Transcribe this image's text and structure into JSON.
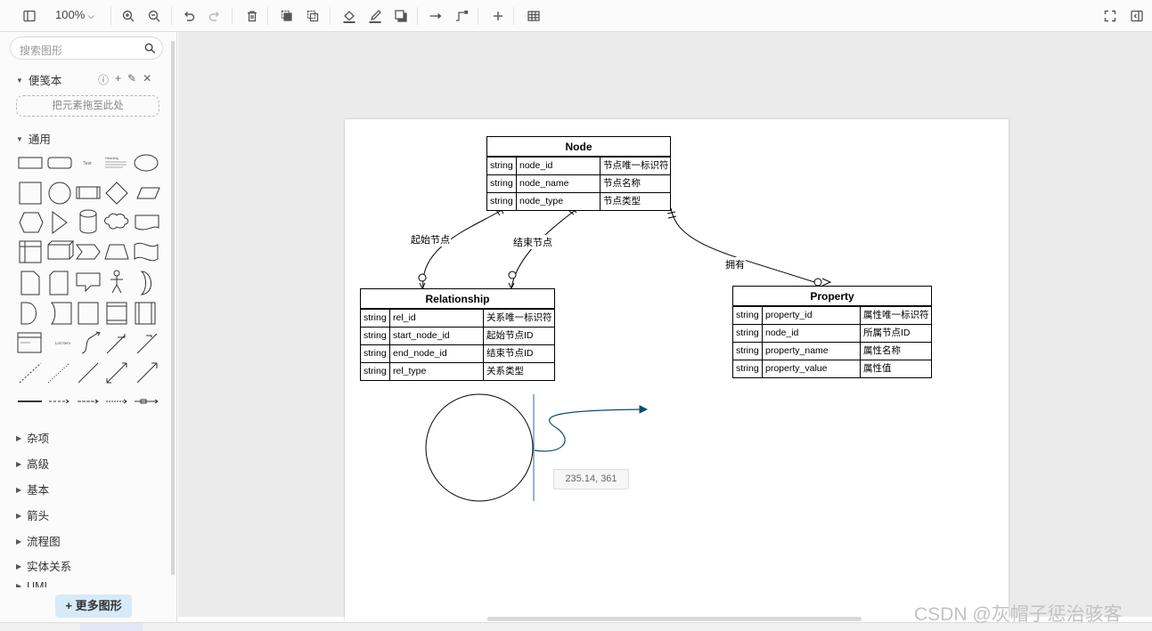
{
  "toolbar": {
    "zoom": "100%",
    "items": [
      "toggle-sidebar",
      "zoom-in",
      "zoom-out",
      "undo",
      "redo",
      "delete",
      "to-front",
      "to-back",
      "fill-color",
      "line-color",
      "shadow",
      "connection-style",
      "waypoints",
      "insert",
      "table",
      "fullscreen",
      "format-panel"
    ]
  },
  "sidebar": {
    "search_placeholder": "搜索图形",
    "scratchpad_title": "便笺本",
    "scratchpad_drop": "把元素拖至此处",
    "general_title": "通用",
    "shape_text_label": "Text",
    "shape_heading_label": "Heading",
    "shape_list_label": "List Item",
    "categories": [
      "杂项",
      "高级",
      "基本",
      "箭头",
      "流程图",
      "实体关系",
      "UML"
    ],
    "more_shapes": "更多图形"
  },
  "diagram": {
    "tables": {
      "node": {
        "title": "Node",
        "rows": [
          [
            "string",
            "node_id",
            "节点唯一标识符"
          ],
          [
            "string",
            "node_name",
            "节点名称"
          ],
          [
            "string",
            "node_type",
            "节点类型"
          ]
        ]
      },
      "relationship": {
        "title": "Relationship",
        "rows": [
          [
            "string",
            "rel_id",
            "关系唯一标识符"
          ],
          [
            "string",
            "start_node_id",
            "起始节点ID"
          ],
          [
            "string",
            "end_node_id",
            "结束节点ID"
          ],
          [
            "string",
            "rel_type",
            "关系类型"
          ]
        ]
      },
      "property": {
        "title": "Property",
        "rows": [
          [
            "string",
            "property_id",
            "属性唯一标识符"
          ],
          [
            "string",
            "node_id",
            "所属节点ID"
          ],
          [
            "string",
            "property_name",
            "属性名称"
          ],
          [
            "string",
            "property_value",
            "属性值"
          ]
        ]
      }
    },
    "edge_labels": {
      "start": "起始节点",
      "end": "结束节点",
      "owns": "拥有"
    },
    "coord_tooltip": "235.14, 361"
  },
  "watermark": "CSDN @灰帽子惩治骇客"
}
